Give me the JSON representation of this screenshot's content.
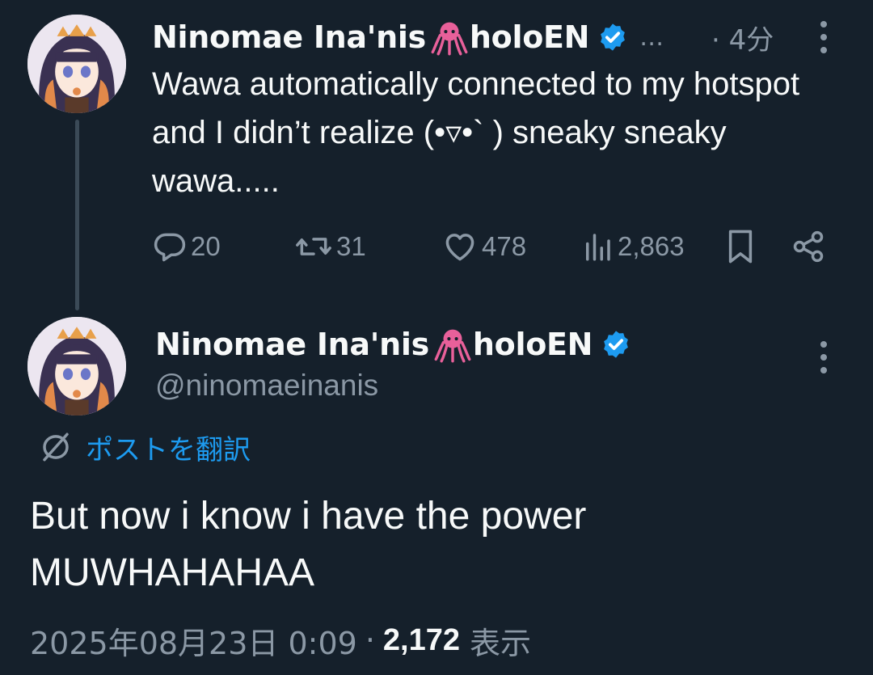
{
  "colors": {
    "background": "#15202b",
    "text_primary": "#f7f9f9",
    "text_secondary": "#8b98a5",
    "accent": "#1d9bf0",
    "verified": "#1d9bf0",
    "octopus": "#e8609a"
  },
  "parent_tweet": {
    "display_name": "Ninomae Ina'nis",
    "name_emoji": "octopus-emoji",
    "name_suffix": "holoEN",
    "verified_icon": "verified-badge-icon",
    "truncation": "…",
    "timestamp": "· 4分",
    "text": "Wawa automatically connected to my hotspot and I didn’t realize (•▿•` ) sneaky sneaky wawa.....",
    "actions": {
      "replies": "20",
      "reposts": "31",
      "likes": "478",
      "views": "2,863"
    },
    "icons": [
      "reply-icon",
      "repost-icon",
      "like-icon",
      "views-icon",
      "bookmark-icon",
      "share-icon",
      "more-icon"
    ]
  },
  "main_tweet": {
    "display_name": "Ninomae Ina'nis",
    "name_emoji": "octopus-emoji",
    "name_suffix": "holoEN",
    "handle": "@ninomaeinanis",
    "translate_label": "ポストを翻訳",
    "text_line1": "But now i know i have the power",
    "text_line2": "MUWHAHAHAA",
    "date": "2025年08月23日 0:09",
    "separator": "·",
    "view_count": "2,172",
    "view_label": "表示"
  }
}
